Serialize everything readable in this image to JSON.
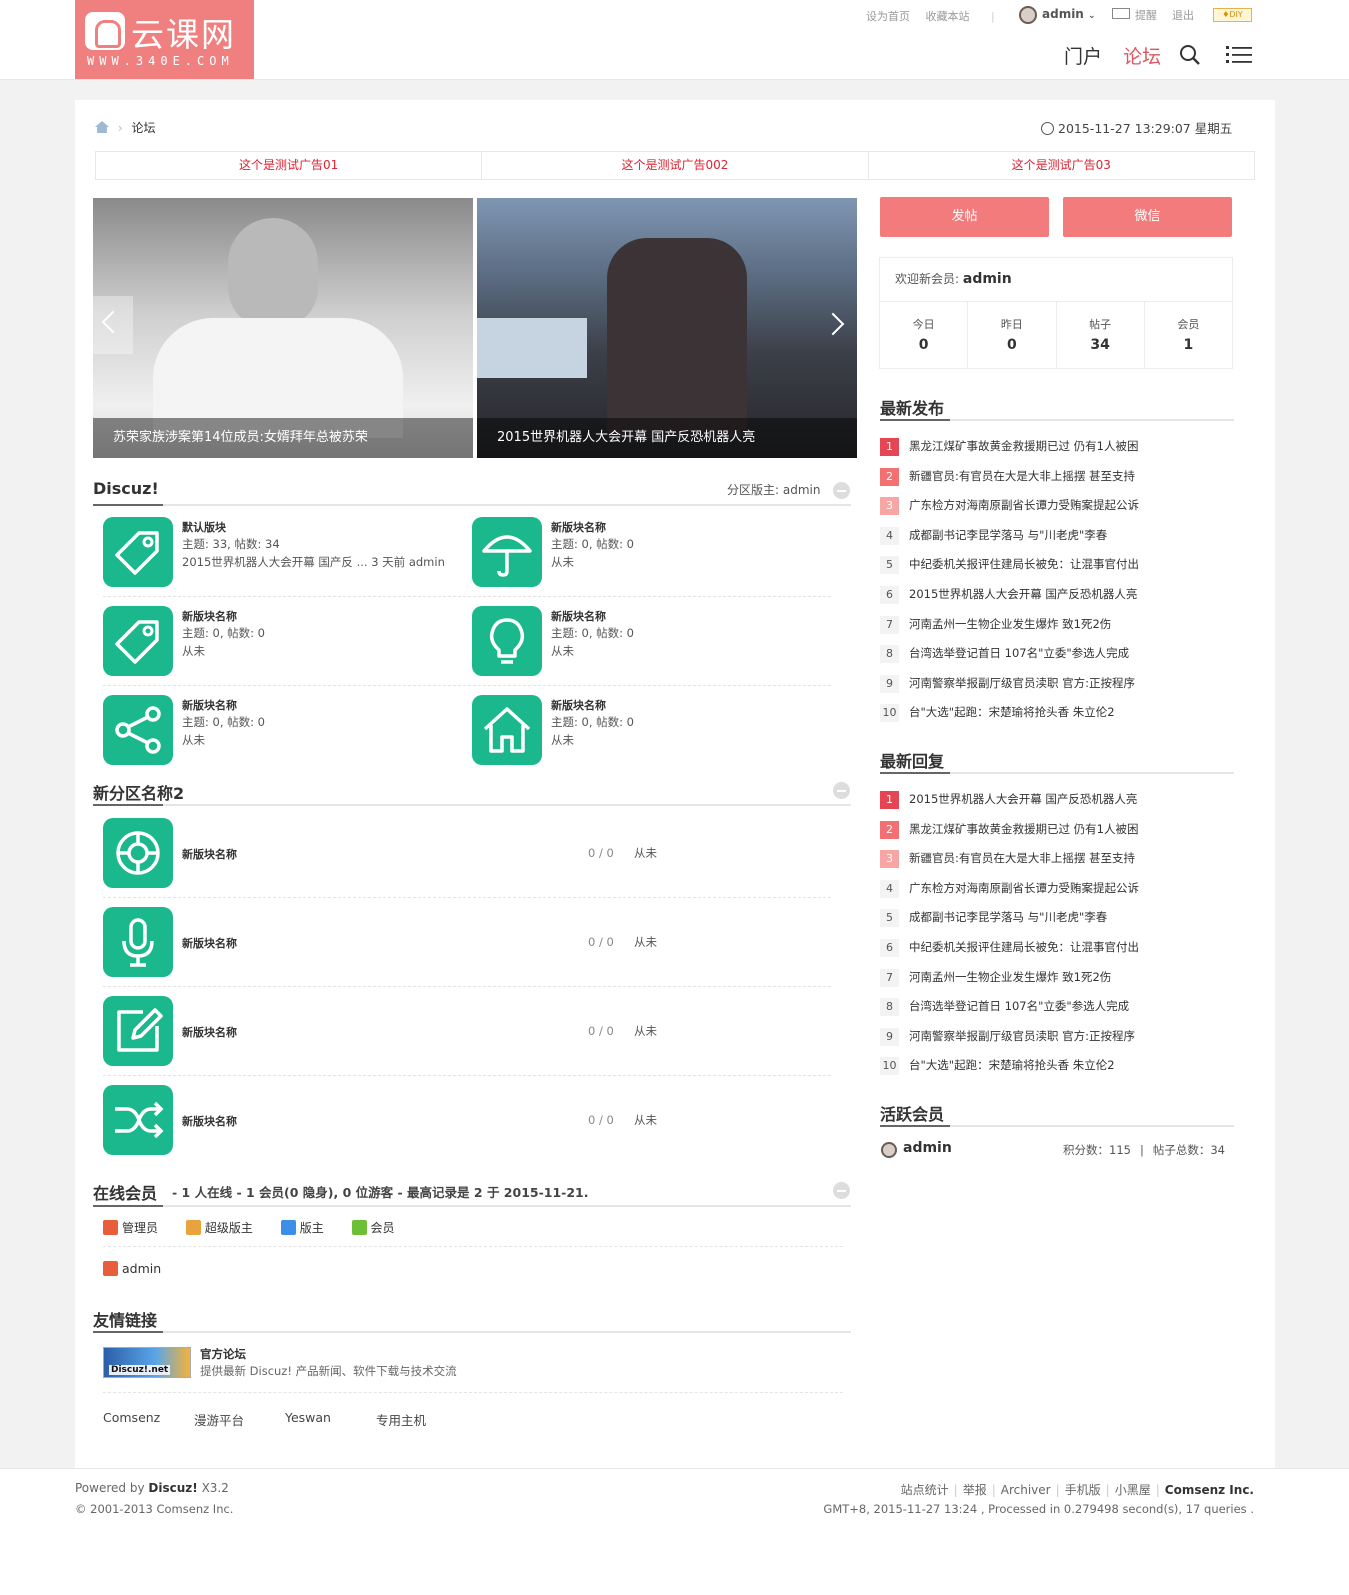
{
  "header": {
    "logo_title": "云课网",
    "logo_subtitle": "WWW.340E.COM",
    "set_home": "设为首页",
    "bookmark": "收藏本站",
    "divider": "|",
    "user": "admin",
    "remind": "提醒",
    "logout": "退出",
    "diy": "♦DIY",
    "nav": [
      "门户",
      "论坛"
    ]
  },
  "breadcrumb": {
    "current": "论坛"
  },
  "datetime": "2015-11-27 13:29:07 星期五",
  "ads": [
    "这个是测试广告01",
    "这个是测试广告002",
    "这个是测试广告03"
  ],
  "slides": [
    "苏荣家族涉案第14位成员:女婿拜年总被苏荣",
    "2015世界机器人大会开幕 国产反恐机器人亮"
  ],
  "section1": {
    "title": "Discuz!",
    "moderator": "分区版主: admin",
    "forums": [
      {
        "name": "默认版块",
        "stats": "主题: 33, 帖数: 34",
        "last": "2015世界机器人大会开幕 国产反 ... 3 天前 admin"
      },
      {
        "name": "新版块名称",
        "stats": "主题: 0, 帖数: 0",
        "last": "从未"
      },
      {
        "name": "新版块名称",
        "stats": "主题: 0, 帖数: 0",
        "last": "从未"
      },
      {
        "name": "新版块名称",
        "stats": "主题: 0, 帖数: 0",
        "last": "从未"
      },
      {
        "name": "新版块名称",
        "stats": "主题: 0, 帖数: 0",
        "last": "从未"
      },
      {
        "name": "新版块名称",
        "stats": "主题: 0, 帖数: 0",
        "last": "从未"
      }
    ]
  },
  "section2": {
    "title": "新分区名称2",
    "forums": [
      {
        "name": "新版块名称",
        "count": "0 / 0",
        "last": "从未"
      },
      {
        "name": "新版块名称",
        "count": "0 / 0",
        "last": "从未"
      },
      {
        "name": "新版块名称",
        "count": "0 / 0",
        "last": "从未"
      },
      {
        "name": "新版块名称",
        "count": "0 / 0",
        "last": "从未"
      }
    ]
  },
  "online": {
    "title": "在线会员",
    "summary": "- 1 人在线 - 1 会员(0 隐身), 0 位游客 - 最高记录是 2 于 2015-11-21.",
    "roles": [
      "管理员",
      "超级版主",
      "版主",
      "会员"
    ],
    "users": [
      "admin"
    ]
  },
  "links": {
    "title": "友情链接",
    "official_name": "官方论坛",
    "official_desc": "提供最新 Discuz! 产品新闻、软件下载与技术交流",
    "logo_text": "Discuz!.net",
    "text_links": [
      "Comsenz",
      "漫游平台",
      "Yeswan",
      "专用主机"
    ]
  },
  "sidebar": {
    "post_btn": "发帖",
    "wechat_btn": "微信",
    "welcome_label": "欢迎新会员:",
    "welcome_user": "admin",
    "stats": [
      {
        "label": "今日",
        "value": "0"
      },
      {
        "label": "昨日",
        "value": "0"
      },
      {
        "label": "帖子",
        "value": "34"
      },
      {
        "label": "会员",
        "value": "1"
      }
    ],
    "latest_title": "最新发布",
    "latest": [
      "黑龙江煤矿事故黄金救援期已过 仍有1人被困",
      "新疆官员:有官员在大是大非上摇摆 甚至支持",
      "广东检方对海南原副省长谭力受贿案提起公诉",
      "成都副书记李昆学落马 与\"川老虎\"李春",
      "中纪委机关报评住建局长被免：让混事官付出",
      "2015世界机器人大会开幕 国产反恐机器人亮",
      "河南孟州一生物企业发生爆炸 致1死2伤",
      "台湾选举登记首日 107名\"立委\"参选人完成",
      "河南警察举报副厅级官员渎职 官方:正按程序",
      "台\"大选\"起跑：宋楚瑜将抢头香 朱立伦2"
    ],
    "reply_title": "最新回复",
    "replies": [
      "2015世界机器人大会开幕 国产反恐机器人亮",
      "黑龙江煤矿事故黄金救援期已过 仍有1人被困",
      "新疆官员:有官员在大是大非上摇摆 甚至支持",
      "广东检方对海南原副省长谭力受贿案提起公诉",
      "成都副书记李昆学落马 与\"川老虎\"李春",
      "中纪委机关报评住建局长被免：让混事官付出",
      "河南孟州一生物企业发生爆炸 致1死2伤",
      "台湾选举登记首日 107名\"立委\"参选人完成",
      "河南警察举报副厅级官员渎职 官方:正按程序",
      "台\"大选\"起跑：宋楚瑜将抢头香 朱立伦2"
    ],
    "active_title": "活跃会员",
    "active_user": "admin",
    "active_points": "积分数：115",
    "active_sep": "|",
    "active_posts": "帖子总数：34"
  },
  "footer": {
    "powered": "Powered by",
    "brand": "Discuz!",
    "version": "X3.2",
    "copyright": "© 2001-2013 Comsenz Inc.",
    "links": [
      "站点统计",
      "举报",
      "Archiver",
      "手机版",
      "小黑屋"
    ],
    "company": "Comsenz Inc.",
    "sep": "|",
    "processed": "GMT+8, 2015-11-27 13:24 , Processed in 0.279498 second(s), 17 queries ."
  }
}
